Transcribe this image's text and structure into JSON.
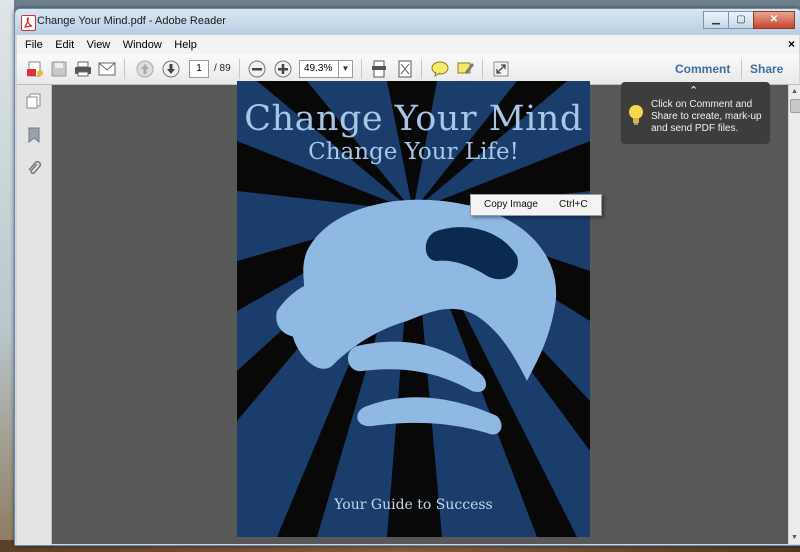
{
  "window": {
    "title": "Change Your Mind.pdf - Adobe Reader",
    "controls": {
      "minimize": "▁",
      "maximize": "▢",
      "close": "✕"
    }
  },
  "menubar": {
    "items": [
      "File",
      "Edit",
      "View",
      "Window",
      "Help"
    ],
    "close_glyph": "×"
  },
  "toolbar": {
    "page_current": "1",
    "page_total": "/ 89",
    "zoom": "49.3%",
    "zoom_dropdown": "▼",
    "comment_label": "Comment",
    "share_label": "Share",
    "icons": [
      "create-pdf-icon",
      "save-icon",
      "print-icon",
      "email-icon",
      "prev-page-icon",
      "next-page-icon",
      "zoom-out-icon",
      "zoom-in-icon",
      "fit-width-icon",
      "fit-page-icon",
      "comment-bubble-icon",
      "highlight-icon",
      "fullscreen-icon"
    ]
  },
  "left_pane": {
    "icons": [
      "pages-icon",
      "bookmark-icon",
      "attachment-icon"
    ]
  },
  "document": {
    "cover_title": "Change Your Mind",
    "cover_subtitle": "Change Your Life!",
    "cover_footer": "Your Guide to Success",
    "colors": {
      "background": "#1a3d6b",
      "rays": "#0a0a0a",
      "face": "#8fb8e2"
    }
  },
  "context_menu": {
    "item_label": "Copy Image",
    "item_shortcut": "Ctrl+C"
  },
  "tooltip": {
    "caret": "⌃",
    "text": "Click on Comment and Share to create, mark-up and send PDF files."
  },
  "scrollbar": {
    "up": "▲",
    "down": "▼"
  }
}
